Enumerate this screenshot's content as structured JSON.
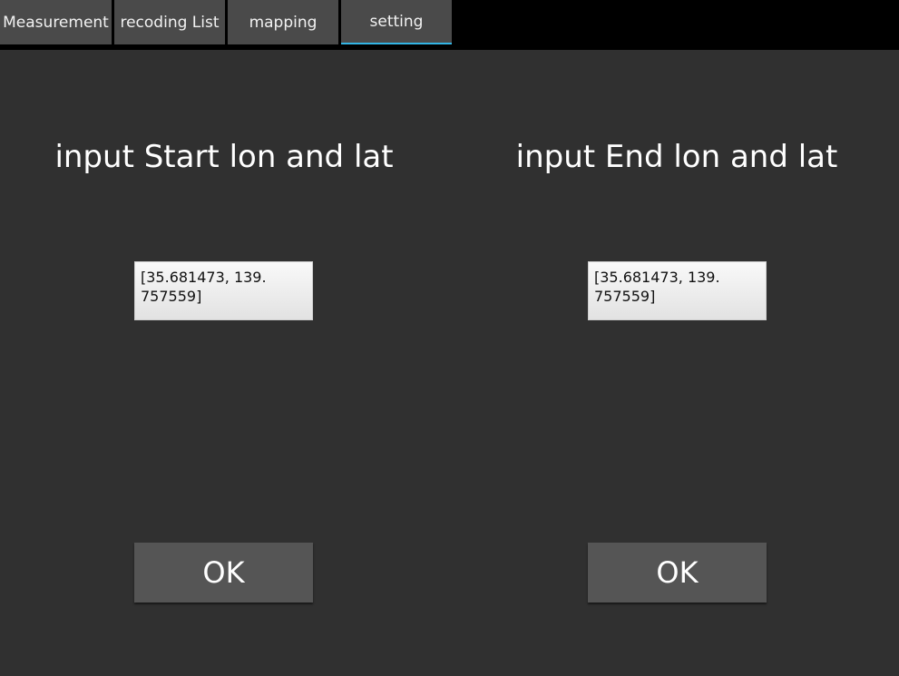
{
  "tabs": [
    {
      "label": "Measurement",
      "active": false
    },
    {
      "label": "recoding List",
      "active": false
    },
    {
      "label": "mapping",
      "active": false
    },
    {
      "label": "setting",
      "active": true
    }
  ],
  "start": {
    "title": "input Start lon and lat",
    "value": "[35.681473, 139.\n757559]",
    "ok_label": "OK"
  },
  "end": {
    "title": "input End lon and lat",
    "value": "[35.681473, 139.\n757559]",
    "ok_label": "OK"
  },
  "colors": {
    "background": "#303030",
    "tabbar": "#000000",
    "tab": "#4a4a4a",
    "tab_active_indicator": "#33b5e5",
    "button": "#555555"
  }
}
